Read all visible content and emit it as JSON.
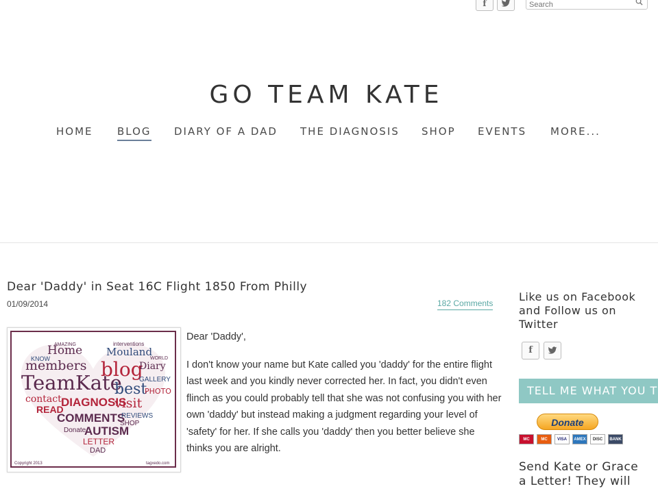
{
  "topbar": {
    "facebook_glyph": "f",
    "twitter_glyph": "t",
    "search_placeholder": "Search"
  },
  "site": {
    "title": "GO TEAM KATE"
  },
  "nav": {
    "items": [
      {
        "label": "HOME"
      },
      {
        "label": "BLOG",
        "active": true
      },
      {
        "label": "DIARY OF A DAD"
      },
      {
        "label": "THE DIAGNOSIS"
      },
      {
        "label": "SHOP"
      },
      {
        "label": "EVENTS"
      },
      {
        "label": "MORE..."
      }
    ]
  },
  "post": {
    "title": "Dear 'Daddy' in Seat 16C Flight 1850 From Philly",
    "date": "01/09/2014",
    "comments": "182 Comments",
    "salutation": "Dear 'Daddy',",
    "paragraph": "I don't know your name but Kate called you 'daddy' for the entire flight last week and you kindly never corrected her.  In fact, you didn't even flinch as you could probably tell that she was not confusing you with her own 'daddy' but instead making a judgment regarding your level of 'safety' for her.  If she calls you 'daddy' then you better believe she thinks you are alright.",
    "word_cloud": {
      "words": [
        "Home",
        "Mouland",
        "members",
        "blog",
        "Diary",
        "TeamKate",
        "best",
        "contact",
        "visit",
        "PHOTO",
        "DIAGNOSIS",
        "READ",
        "COMMENTS",
        "AUTISM",
        "REVIEWS",
        "SHOP",
        "GALLERY",
        "KNOW",
        "Donate",
        "LETTER",
        "DAD",
        "interventions",
        "AMAZING",
        "WORLD"
      ],
      "footer_left": "Copyright 2013",
      "footer_right": "tagxedo.com"
    }
  },
  "sidebar": {
    "social_heading": "Like us on Facebook and Follow us on Twitter",
    "cta_button": "TELL ME WHAT YOU THINK",
    "donate_label": "Donate",
    "cards": [
      "MC",
      "MC",
      "VISA",
      "AMEX",
      "DISC",
      "BANK"
    ],
    "letter_text": "Send Kate or Grace a Letter!  They will"
  },
  "colors": {
    "accent_teal": "#5aa8a4",
    "button_teal": "#8fc8c4",
    "cloud_red": "#b3243a",
    "cloud_purple": "#5b2a4e",
    "cloud_blue": "#2f4a7a"
  }
}
